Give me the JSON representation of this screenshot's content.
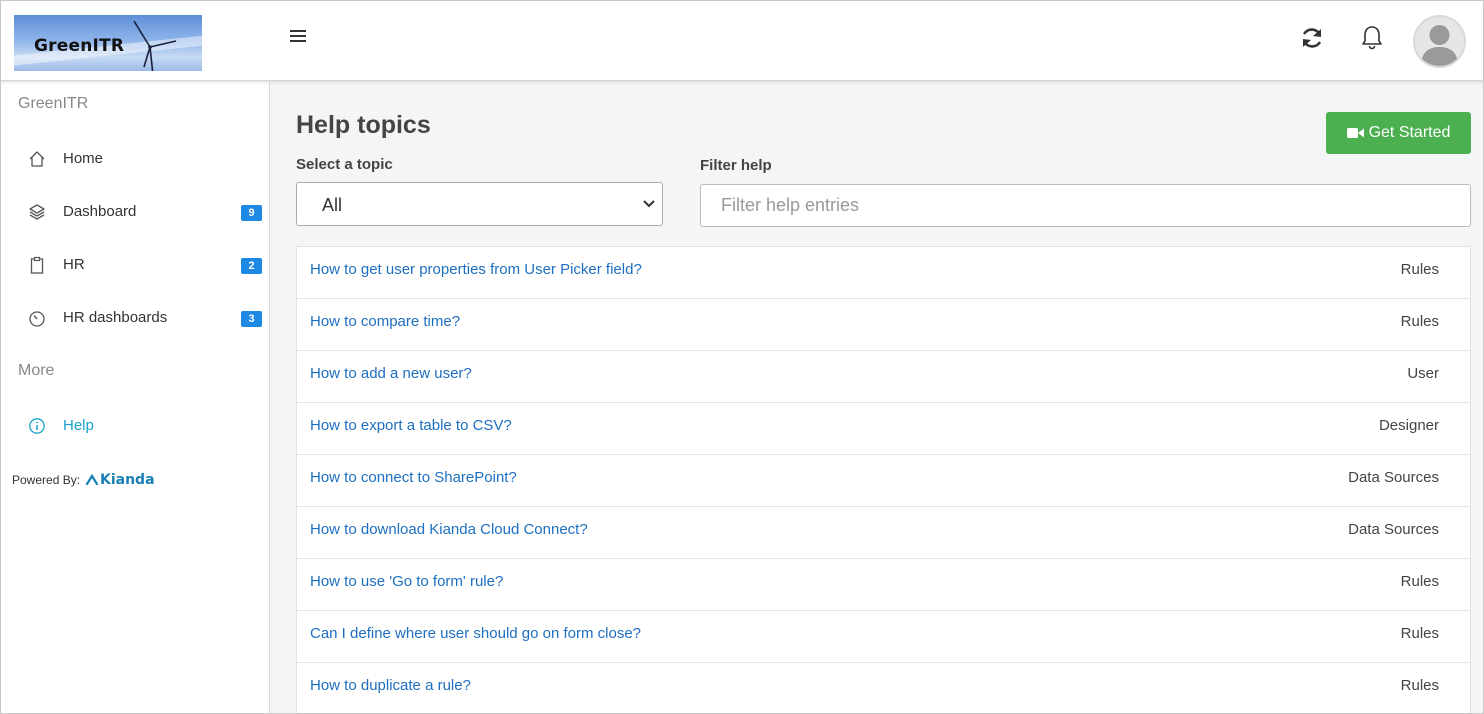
{
  "header": {
    "logo_text": "GreenITR"
  },
  "sidebar": {
    "app_name": "GreenITR",
    "items": [
      {
        "label": "Home",
        "icon": "home-icon",
        "badge": ""
      },
      {
        "label": "Dashboard",
        "icon": "layers-icon",
        "badge": "9"
      },
      {
        "label": "HR",
        "icon": "clipboard-icon",
        "badge": "2"
      },
      {
        "label": "HR dashboards",
        "icon": "gauge-icon",
        "badge": "3"
      }
    ],
    "more_label": "More",
    "help_label": "Help",
    "powered_by": "Powered By:",
    "brand": "Kianda"
  },
  "main": {
    "title": "Help topics",
    "get_started": "Get Started",
    "topic_label": "Select a topic",
    "topic_value": "All",
    "filter_label": "Filter help",
    "filter_placeholder": "Filter help entries",
    "entries": [
      {
        "title": "How to get user properties from User Picker field?",
        "category": "Rules"
      },
      {
        "title": "How to compare time?",
        "category": "Rules"
      },
      {
        "title": "How to add a new user?",
        "category": "User"
      },
      {
        "title": "How to export a table to CSV?",
        "category": "Designer"
      },
      {
        "title": "How to connect to SharePoint?",
        "category": "Data Sources"
      },
      {
        "title": "How to download Kianda Cloud Connect?",
        "category": "Data Sources"
      },
      {
        "title": "How to use 'Go to form' rule?",
        "category": "Rules"
      },
      {
        "title": "Can I define where user should go on form close?",
        "category": "Rules"
      },
      {
        "title": "How to duplicate a rule?",
        "category": "Rules"
      }
    ]
  },
  "colors": {
    "accent_green": "#4caf50",
    "badge_blue": "#1e88e5",
    "link_blue": "#1e6fc0",
    "active_teal": "#17a2c9"
  }
}
